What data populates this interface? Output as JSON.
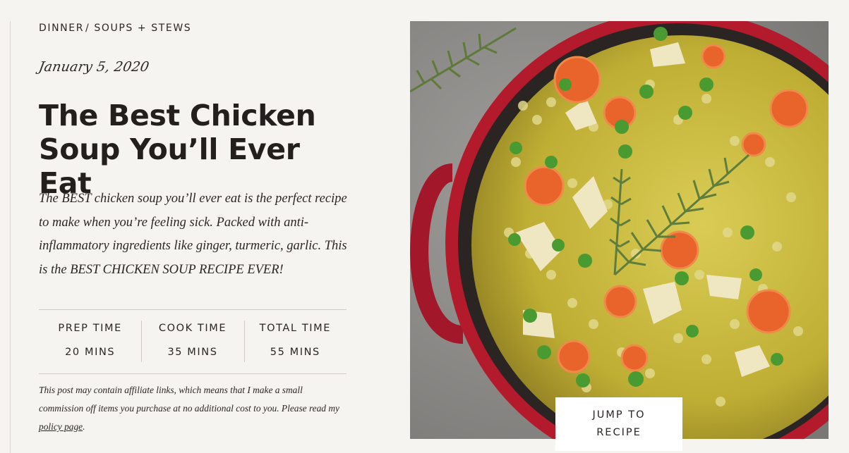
{
  "breadcrumb": {
    "category_1": "DINNER",
    "separator": "/",
    "category_2": "SOUPS + STEWS"
  },
  "post": {
    "date": "January 5, 2020",
    "title_line_1": "The Best Chicken",
    "title_line_2": "Soup You’ll Ever Eat",
    "excerpt": "The BEST chicken soup you’ll ever eat is the perfect recipe to make when you’re feeling sick. Packed with anti-inflammatory ingredients like ginger, turmeric, garlic. This is the BEST CHICKEN SOUP RECIPE EVER!"
  },
  "times": [
    {
      "label": "PREP TIME",
      "value": "20 MINS"
    },
    {
      "label": "COOK TIME",
      "value": "35 MINS"
    },
    {
      "label": "TOTAL TIME",
      "value": "55 MINS"
    }
  ],
  "disclaimer": {
    "text": "This post may contain affiliate links, which means that I make a small commission off items you purchase at no additional cost to you. Please read my ",
    "link_text": "policy page",
    "end": "."
  },
  "hero_image": {
    "subject": "chicken soup in red dutch oven with carrots, peas, pearl couscous and rosemary"
  },
  "jump_button": {
    "line_1": "JUMP TO",
    "line_2": "RECIPE"
  },
  "colors": {
    "background": "#f6f4f1",
    "text": "#2a2624",
    "pot_red": "#b31b2c",
    "broth": "#c9b83a",
    "carrot": "#e8642a",
    "pea": "#4a9a32"
  }
}
